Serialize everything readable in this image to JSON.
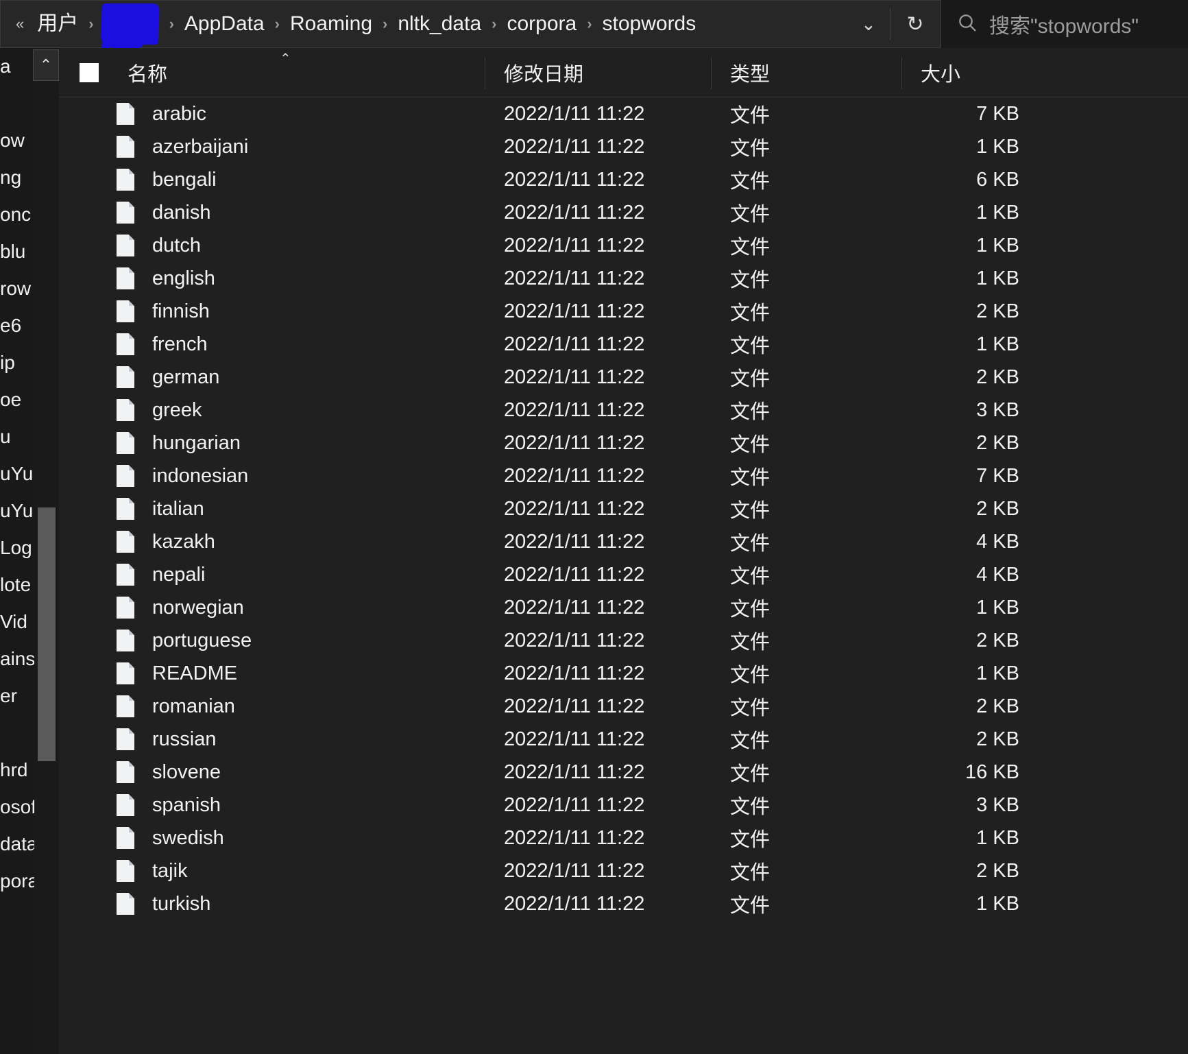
{
  "window": {
    "title_bar_bg": "#191919",
    "accent_redaction_color": "#1a0fe0"
  },
  "address_bar": {
    "overflow_indicator": "«",
    "crumbs": [
      {
        "label": "用户",
        "redacted": false
      },
      {
        "label": "",
        "redacted": true
      },
      {
        "label": "AppData",
        "redacted": false
      },
      {
        "label": "Roaming",
        "redacted": false
      },
      {
        "label": "nltk_data",
        "redacted": false
      },
      {
        "label": "corpora",
        "redacted": false
      },
      {
        "label": "stopwords",
        "redacted": false
      }
    ],
    "separator": "›",
    "dropdown_glyph": "⌄",
    "refresh_glyph": "↻"
  },
  "search": {
    "placeholder": "搜索\"stopwords\"",
    "icon": "search-icon"
  },
  "nav_pane": {
    "top_button_glyph": "⌃",
    "items": [
      {
        "label": "a"
      },
      {
        "label": ""
      },
      {
        "label": "ow"
      },
      {
        "label": "ng"
      },
      {
        "label": "onc"
      },
      {
        "label": "blu"
      },
      {
        "label": "row"
      },
      {
        "label": "e6"
      },
      {
        "label": "ip"
      },
      {
        "label": "oe"
      },
      {
        "label": "u"
      },
      {
        "label": "uYun"
      },
      {
        "label": "uYun"
      },
      {
        "label": "Log"
      },
      {
        "label": "lote"
      },
      {
        "label": "Vid"
      },
      {
        "label": "ains"
      },
      {
        "label": "er"
      },
      {
        "label": ""
      },
      {
        "label": "hrd"
      },
      {
        "label": "osof"
      },
      {
        "label": "data"
      },
      {
        "label": "pora"
      }
    ]
  },
  "columns": {
    "select_all": "",
    "name": "名称",
    "date_modified": "修改日期",
    "type": "类型",
    "size": "大小",
    "sort_caret": "⌃"
  },
  "files": [
    {
      "name": "arabic",
      "date": "2022/1/11 11:22",
      "type": "文件",
      "size": "7 KB"
    },
    {
      "name": "azerbaijani",
      "date": "2022/1/11 11:22",
      "type": "文件",
      "size": "1 KB"
    },
    {
      "name": "bengali",
      "date": "2022/1/11 11:22",
      "type": "文件",
      "size": "6 KB"
    },
    {
      "name": "danish",
      "date": "2022/1/11 11:22",
      "type": "文件",
      "size": "1 KB"
    },
    {
      "name": "dutch",
      "date": "2022/1/11 11:22",
      "type": "文件",
      "size": "1 KB"
    },
    {
      "name": "english",
      "date": "2022/1/11 11:22",
      "type": "文件",
      "size": "1 KB"
    },
    {
      "name": "finnish",
      "date": "2022/1/11 11:22",
      "type": "文件",
      "size": "2 KB"
    },
    {
      "name": "french",
      "date": "2022/1/11 11:22",
      "type": "文件",
      "size": "1 KB"
    },
    {
      "name": "german",
      "date": "2022/1/11 11:22",
      "type": "文件",
      "size": "2 KB"
    },
    {
      "name": "greek",
      "date": "2022/1/11 11:22",
      "type": "文件",
      "size": "3 KB"
    },
    {
      "name": "hungarian",
      "date": "2022/1/11 11:22",
      "type": "文件",
      "size": "2 KB"
    },
    {
      "name": "indonesian",
      "date": "2022/1/11 11:22",
      "type": "文件",
      "size": "7 KB"
    },
    {
      "name": "italian",
      "date": "2022/1/11 11:22",
      "type": "文件",
      "size": "2 KB"
    },
    {
      "name": "kazakh",
      "date": "2022/1/11 11:22",
      "type": "文件",
      "size": "4 KB"
    },
    {
      "name": "nepali",
      "date": "2022/1/11 11:22",
      "type": "文件",
      "size": "4 KB"
    },
    {
      "name": "norwegian",
      "date": "2022/1/11 11:22",
      "type": "文件",
      "size": "1 KB"
    },
    {
      "name": "portuguese",
      "date": "2022/1/11 11:22",
      "type": "文件",
      "size": "2 KB"
    },
    {
      "name": "README",
      "date": "2022/1/11 11:22",
      "type": "文件",
      "size": "1 KB"
    },
    {
      "name": "romanian",
      "date": "2022/1/11 11:22",
      "type": "文件",
      "size": "2 KB"
    },
    {
      "name": "russian",
      "date": "2022/1/11 11:22",
      "type": "文件",
      "size": "2 KB"
    },
    {
      "name": "slovene",
      "date": "2022/1/11 11:22",
      "type": "文件",
      "size": "16 KB"
    },
    {
      "name": "spanish",
      "date": "2022/1/11 11:22",
      "type": "文件",
      "size": "3 KB"
    },
    {
      "name": "swedish",
      "date": "2022/1/11 11:22",
      "type": "文件",
      "size": "1 KB"
    },
    {
      "name": "tajik",
      "date": "2022/1/11 11:22",
      "type": "文件",
      "size": "2 KB"
    },
    {
      "name": "turkish",
      "date": "2022/1/11 11:22",
      "type": "文件",
      "size": "1 KB"
    }
  ]
}
